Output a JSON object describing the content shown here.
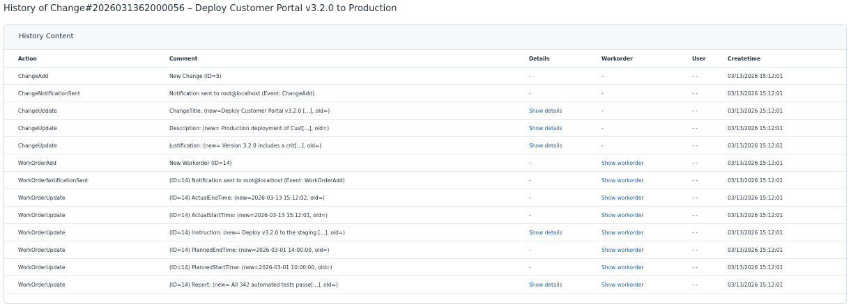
{
  "page": {
    "title": "History of Change#2026031362000056 – Deploy Customer Portal v3.2.0 to Production"
  },
  "panel": {
    "title": "History Content"
  },
  "table": {
    "columns": [
      "Action",
      "Comment",
      "Details",
      "Workorder",
      "User",
      "Createtime"
    ],
    "rows": [
      {
        "action": "ChangeAdd",
        "comment": "New Change (ID=5)",
        "details": "-",
        "details_link": false,
        "workorder": "-",
        "workorder_link": false,
        "user": "- -",
        "createtime": "03/13/2026 15:12:01"
      },
      {
        "action": "ChangeNotificationSent",
        "comment": "Notification sent to root@localhost (Event: ChangeAdd)",
        "details": "-",
        "details_link": false,
        "workorder": "-",
        "workorder_link": false,
        "user": "- -",
        "createtime": "03/13/2026 15:12:01"
      },
      {
        "action": "ChangeUpdate",
        "comment": "ChangeTitle: (new=Deploy Customer Portal v3.2.0 [...], old=)",
        "details": "Show details",
        "details_link": true,
        "workorder": "-",
        "workorder_link": false,
        "user": "- -",
        "createtime": "03/13/2026 15:12:01"
      },
      {
        "action": "ChangeUpdate",
        "comment": "Description: (new= Production deployment of Cust[...], old=)",
        "details": "Show details",
        "details_link": true,
        "workorder": "-",
        "workorder_link": false,
        "user": "- -",
        "createtime": "03/13/2026 15:12:01"
      },
      {
        "action": "ChangeUpdate",
        "comment": "Justification: (new= Version 3.2.0 includes a crit[...], old=)",
        "details": "Show details",
        "details_link": true,
        "workorder": "-",
        "workorder_link": false,
        "user": "- -",
        "createtime": "03/13/2026 15:12:01"
      },
      {
        "action": "WorkOrderAdd",
        "comment": "New Workorder (ID=14)",
        "details": "-",
        "details_link": false,
        "workorder": "Show workorder",
        "workorder_link": true,
        "user": "- -",
        "createtime": "03/13/2026 15:12:01"
      },
      {
        "action": "WorkOrderNotificationSent",
        "comment": "(ID=14) Notification sent to root@localhost (Event: WorkOrderAdd)",
        "details": "-",
        "details_link": false,
        "workorder": "Show workorder",
        "workorder_link": true,
        "user": "- -",
        "createtime": "03/13/2026 15:12:01"
      },
      {
        "action": "WorkOrderUpdate",
        "comment": "(ID=14) ActualEndTime: (new=2026-03-13 15:12:02, old=)",
        "details": "-",
        "details_link": false,
        "workorder": "Show workorder",
        "workorder_link": true,
        "user": "- -",
        "createtime": "03/13/2026 15:12:01"
      },
      {
        "action": "WorkOrderUpdate",
        "comment": "(ID=14) ActualStartTime: (new=2026-03-13 15:12:01, old=)",
        "details": "-",
        "details_link": false,
        "workorder": "Show workorder",
        "workorder_link": true,
        "user": "- -",
        "createtime": "03/13/2026 15:12:01"
      },
      {
        "action": "WorkOrderUpdate",
        "comment": "(ID=14) Instruction: (new= Deploy v3.2.0 to the staging [...], old=)",
        "details": "Show details",
        "details_link": true,
        "workorder": "Show workorder",
        "workorder_link": true,
        "user": "- -",
        "createtime": "03/13/2026 15:12:01"
      },
      {
        "action": "WorkOrderUpdate",
        "comment": "(ID=14) PlannedEndTime: (new=2026-03-01 14:00:00, old=)",
        "details": "-",
        "details_link": false,
        "workorder": "Show workorder",
        "workorder_link": true,
        "user": "- -",
        "createtime": "03/13/2026 15:12:01"
      },
      {
        "action": "WorkOrderUpdate",
        "comment": "(ID=14) PlannedStartTime: (new=2026-03-01 10:00:00, old=)",
        "details": "-",
        "details_link": false,
        "workorder": "Show workorder",
        "workorder_link": true,
        "user": "- -",
        "createtime": "03/13/2026 15:12:01"
      },
      {
        "action": "WorkOrderUpdate",
        "comment": "(ID=14) Report: (new= All 342 automated tests passe[...], old=)",
        "details": "Show details",
        "details_link": true,
        "workorder": "Show workorder",
        "workorder_link": true,
        "user": "- -",
        "createtime": "03/13/2026 15:12:01"
      }
    ]
  },
  "colors": {
    "link": "#1a62b5",
    "text": "#1f2f3f",
    "header_bg": "#f6f9fc",
    "border": "#d6dee8"
  }
}
